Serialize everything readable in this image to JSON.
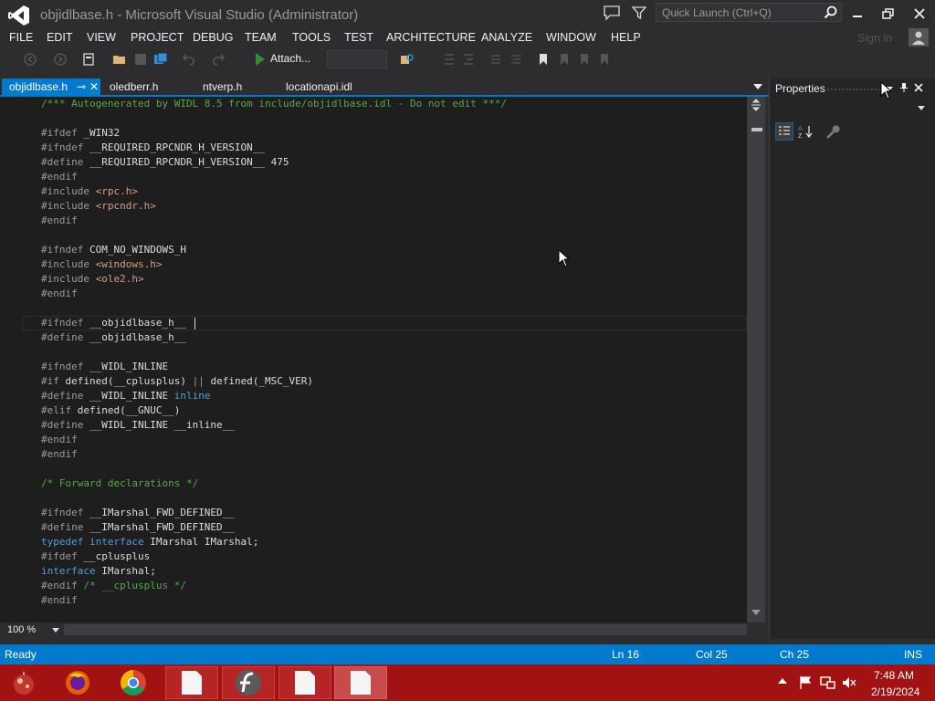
{
  "window": {
    "title": "objidlbase.h - Microsoft Visual Studio (Administrator)",
    "quick_launch_placeholder": "Quick Launch (Ctrl+Q)",
    "sign_in": "Sign in"
  },
  "menu": [
    "FILE",
    "EDIT",
    "VIEW",
    "PROJECT",
    "DEBUG",
    "TEAM",
    "TOOLS",
    "TEST",
    "ARCHITECTURE",
    "ANALYZE",
    "WINDOW",
    "HELP"
  ],
  "toolbar": {
    "attach_label": "Attach..."
  },
  "tabs": [
    "objidlbase.h",
    "oledberr.h",
    "ntverp.h",
    "locationapi.idl"
  ],
  "editor": {
    "zoom": "100 %",
    "lines": [
      "/*** Autogenerated by WIDL 8.5 from include/objidlbase.idl - Do not edit ***/",
      "",
      "#ifdef _WIN32",
      "#ifndef __REQUIRED_RPCNDR_H_VERSION__",
      "#define __REQUIRED_RPCNDR_H_VERSION__ 475",
      "#endif",
      "#include <rpc.h>",
      "#include <rpcndr.h>",
      "#endif",
      "",
      "#ifndef COM_NO_WINDOWS_H",
      "#include <windows.h>",
      "#include <ole2.h>",
      "#endif",
      "",
      "#ifndef __objidlbase_h__",
      "#define __objidlbase_h__",
      "",
      "#ifndef __WIDL_INLINE",
      "#if defined(__cplusplus) || defined(_MSC_VER)",
      "#define __WIDL_INLINE inline",
      "#elif defined(__GNUC__)",
      "#define __WIDL_INLINE __inline__",
      "#endif",
      "#endif",
      "",
      "/* Forward declarations */",
      "",
      "#ifndef __IMarshal_FWD_DEFINED__",
      "#define __IMarshal_FWD_DEFINED__",
      "typedef interface IMarshal IMarshal;",
      "#ifdef __cplusplus",
      "interface IMarshal;",
      "#endif /* __cplusplus */",
      "#endif"
    ]
  },
  "properties": {
    "title": "Properties"
  },
  "status": {
    "state": "Ready",
    "line": "Ln 16",
    "col": "Col 25",
    "ch": "Ch 25",
    "mode": "INS"
  },
  "taskbar": {
    "time": "7:48 AM",
    "date": "2/19/2024"
  },
  "colors": {
    "accent": "#007acc",
    "taskbar": "#a31212",
    "editor_bg": "#1e1e1e"
  }
}
